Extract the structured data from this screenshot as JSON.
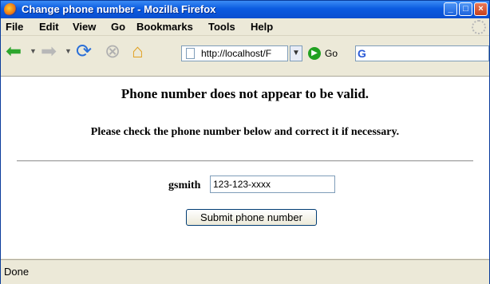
{
  "window": {
    "title": "Change phone number - Mozilla Firefox",
    "controls": [
      "minimize",
      "maximize",
      "close"
    ]
  },
  "menu": [
    "File",
    "Edit",
    "View",
    "Go",
    "Bookmarks",
    "Tools",
    "Help"
  ],
  "toolbar": {
    "url": "http://localhost/F",
    "go_label": "Go",
    "search_logo": "G",
    "icons": [
      "back-arrow-icon",
      "forward-arrow-icon",
      "reload-icon",
      "stop-icon",
      "home-icon",
      "page-icon",
      "go-icon",
      "google-icon"
    ]
  },
  "page": {
    "heading": "Phone number does not appear to be valid.",
    "message": "Please check the phone number below and correct it if necessary.",
    "username": "gsmith",
    "phone_value": "123-123-xxxx",
    "submit_label": "Submit phone number"
  },
  "status": "Done",
  "colors": {
    "titlebar": "#0b5be0",
    "chrome": "#ece9d8",
    "close": "#c6401c"
  }
}
